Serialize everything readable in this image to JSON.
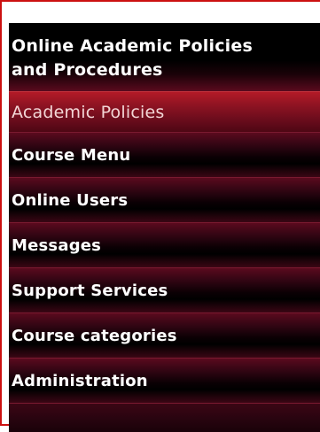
{
  "menu": {
    "header_line1": "Online Academic Policies",
    "header_line2": "and Procedures",
    "selected": "Academic Policies",
    "items": [
      "Course Menu",
      "Online Users",
      "Messages",
      "Support Services",
      "Course categories",
      "Administration"
    ]
  },
  "colors": {
    "border": "#cc1010",
    "item_text": "#ffffff",
    "selected_bg": "#8c1322"
  }
}
